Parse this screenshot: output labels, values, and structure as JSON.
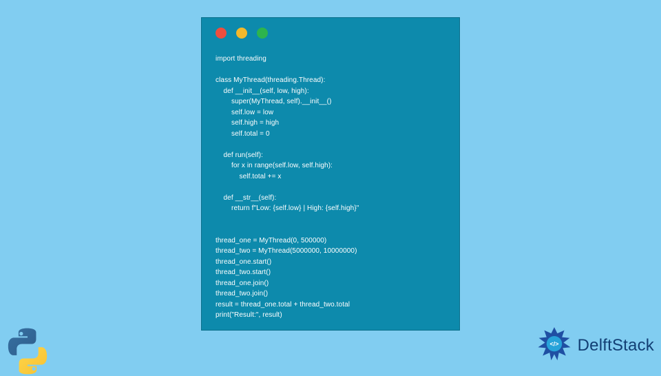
{
  "code_lines": [
    "import threading",
    "",
    "class MyThread(threading.Thread):",
    "    def __init__(self, low, high):",
    "        super(MyThread, self).__init__()",
    "        self.low = low",
    "        self.high = high",
    "        self.total = 0",
    "",
    "    def run(self):",
    "        for x in range(self.low, self.high):",
    "            self.total += x",
    "",
    "    def __str__(self):",
    "        return f\"Low: {self.low} | High: {self.high}\"",
    "",
    "",
    "thread_one = MyThread(0, 500000)",
    "thread_two = MyThread(5000000, 10000000)",
    "thread_one.start()",
    "thread_two.start()",
    "thread_one.join()",
    "thread_two.join()",
    "result = thread_one.total + thread_two.total",
    "print(\"Result:\", result)"
  ],
  "brand": {
    "text": "DelftStack"
  },
  "colors": {
    "background": "#81cdf1",
    "window": "#0d8aac",
    "traffic_red": "#ee4e3e",
    "traffic_yellow": "#f2b82b",
    "traffic_green": "#2db44d",
    "brand_text": "#123f74"
  }
}
